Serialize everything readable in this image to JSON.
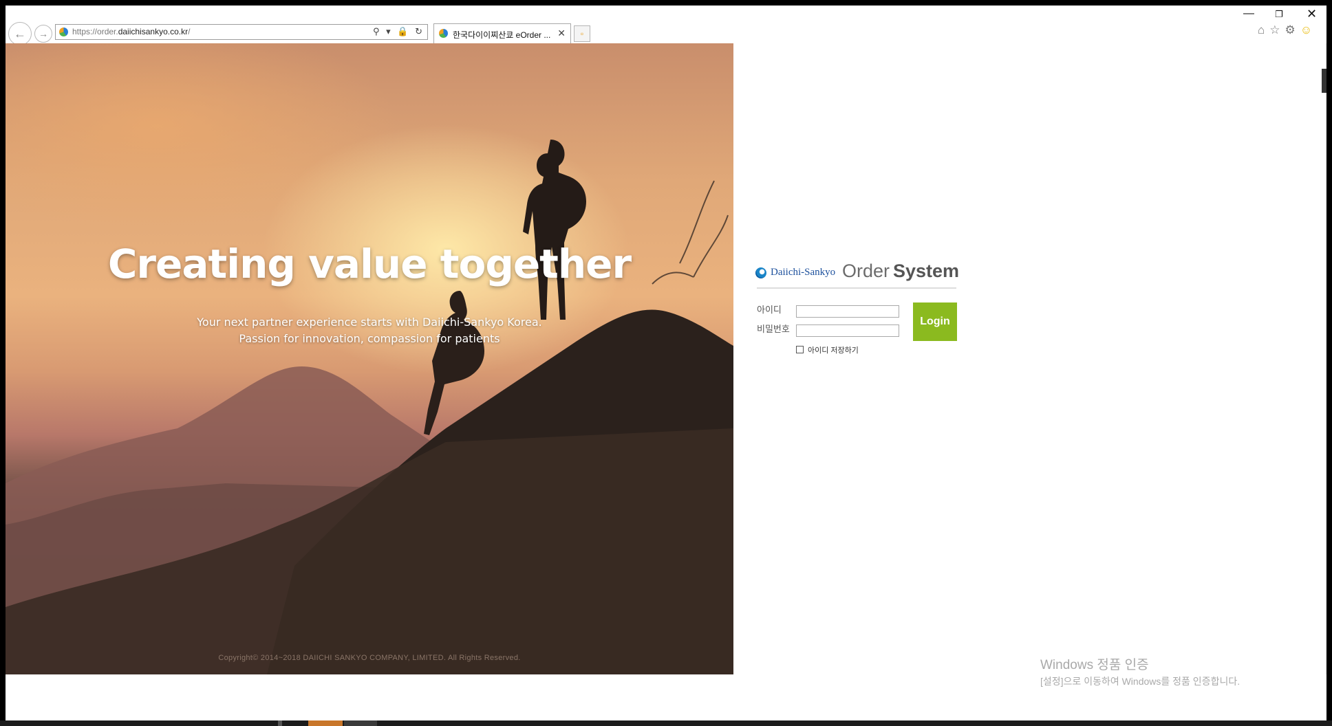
{
  "browser": {
    "url_prefix": "https://order.",
    "url_domain": "daiichisankyo.co.kr",
    "url_suffix": "/",
    "address_icons": "⚲ ▾ 🔒 ↻",
    "tab_title": "한국다이이찌산쿄 eOrder ...",
    "tab_close": "✕",
    "new_tab": "▫",
    "window_minimize": "—",
    "window_restore": "❐",
    "window_close": "✕",
    "toolbar_home": "⌂",
    "toolbar_favorites": "☆",
    "toolbar_settings": "⚙",
    "toolbar_smiley": "☺",
    "back": "←",
    "forward": "→"
  },
  "hero": {
    "title": "Creating value together",
    "subtitle_line1": "Your next partner experience starts with Daiichi-Sankyo Korea.",
    "subtitle_line2": "Passion for innovation, compassion for patients",
    "copyright": "Copyright© 2014~2018 DAIICHI SANKYO COMPANY, LIMITED. All Rights Reserved."
  },
  "login": {
    "brand_company": "Daiichi-Sankyo",
    "brand_order": "Order",
    "brand_system": "System",
    "id_label": "아이디",
    "password_label": "비밀번호",
    "id_value": "",
    "password_value": "",
    "remember_label": "아이디 저장하기",
    "remember_checked": false,
    "login_button": "Login",
    "button_color": "#8bba1f"
  },
  "activation": {
    "title": "Windows 정품 인증",
    "subtitle": "[설정]으로 이동하여 Windows를 정품 인증합니다."
  }
}
